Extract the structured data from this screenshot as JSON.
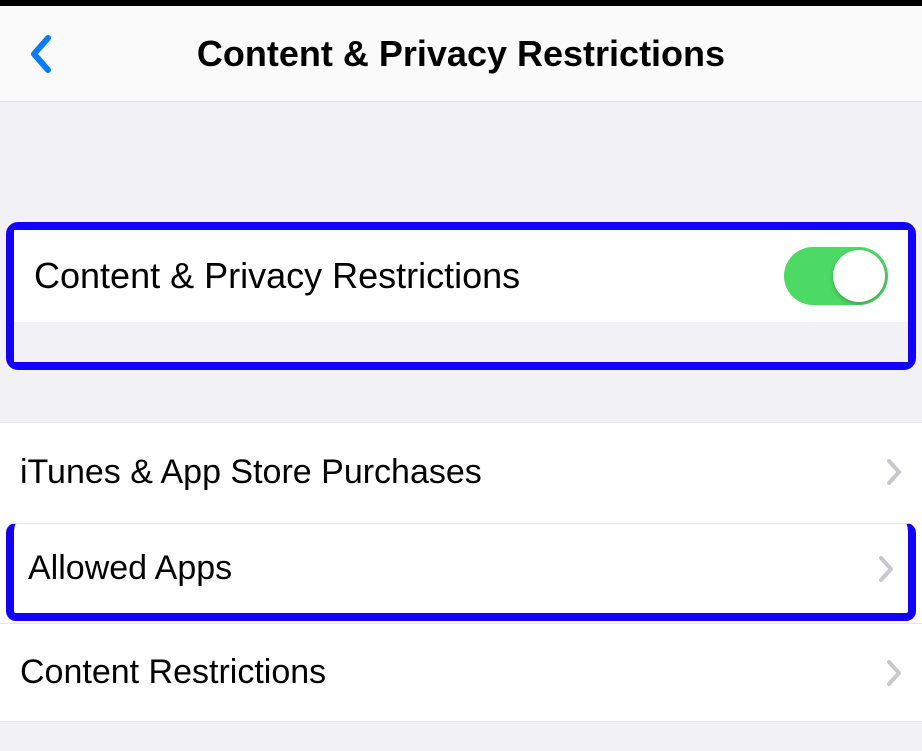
{
  "header": {
    "title": "Content & Privacy Restrictions"
  },
  "toggle_section": {
    "label": "Content & Privacy Restrictions",
    "enabled": true
  },
  "rows": {
    "itunes": "iTunes & App Store Purchases",
    "allowed_apps": "Allowed Apps",
    "content_restrictions": "Content Restrictions"
  },
  "colors": {
    "highlight": "#1400ff",
    "toggle_on": "#4cd964",
    "back_arrow": "#0a7aff"
  }
}
